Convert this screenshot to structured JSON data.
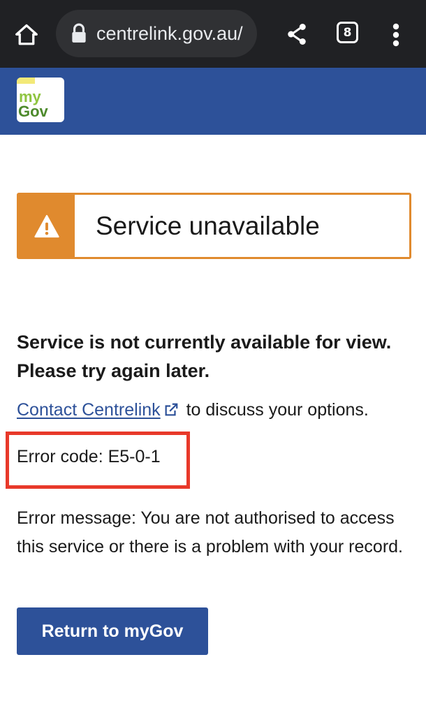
{
  "browser": {
    "url": "centrelink.gov.au/",
    "tab_count": "8",
    "icons": {
      "home": "home-icon",
      "lock": "lock-icon",
      "share": "share-icon",
      "menu": "more-vert-icon"
    }
  },
  "header": {
    "logo_line1": "my",
    "logo_line2": "Gov",
    "background_color": "#2d5199"
  },
  "alert": {
    "title": "Service unavailable",
    "icon": "warning-icon",
    "accent_color": "#e08a2e"
  },
  "main": {
    "heading": "Service is not currently available for view. Please try again later.",
    "contact_link": "Contact Centrelink",
    "contact_suffix": " to discuss your options.",
    "error_code": "Error code: E5-0-1",
    "error_message": "Error message: You are not authorised to access this service or there is a problem with your record.",
    "return_button": "Return to myGov",
    "highlight_color": "#e8392a"
  }
}
